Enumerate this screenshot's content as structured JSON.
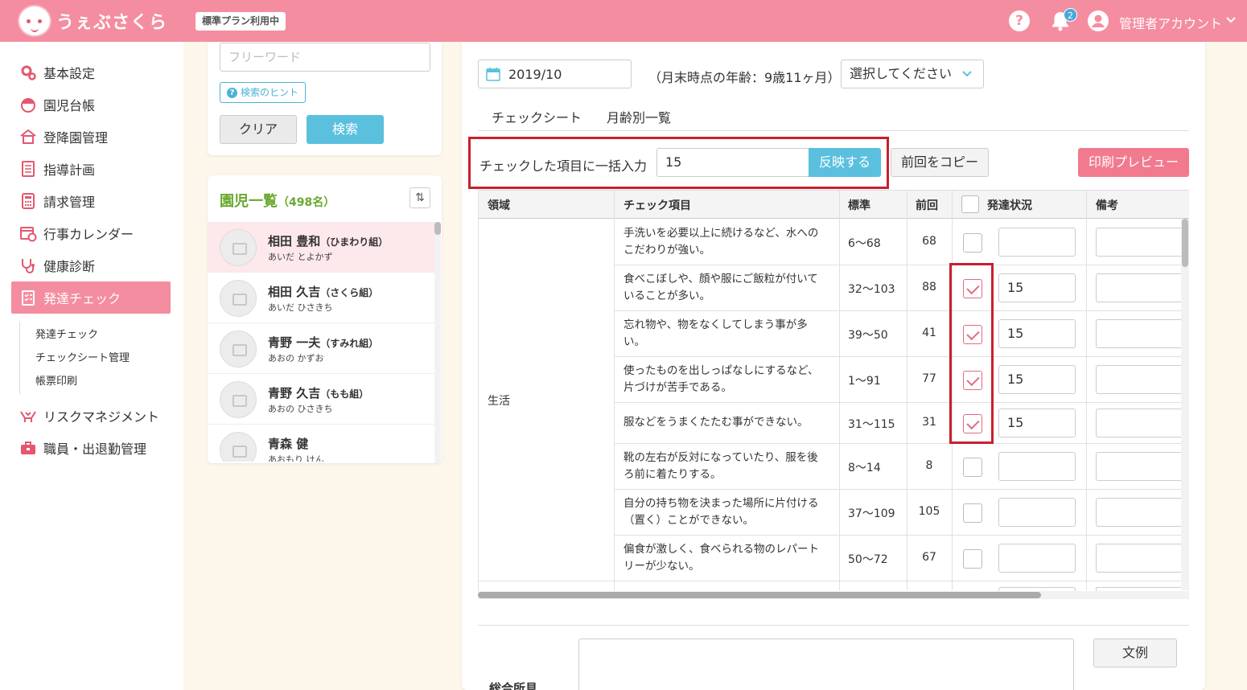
{
  "header": {
    "app_name": "うぇぶさくら",
    "plan_badge": "標準プラン利用中",
    "notification_count": "2",
    "account_name": "管理者アカウント",
    "brand_color": "#f48da0"
  },
  "sidebar": {
    "items": [
      {
        "label": "基本設定",
        "icon": "gear-icon"
      },
      {
        "label": "園児台帳",
        "icon": "child-icon"
      },
      {
        "label": "登降園管理",
        "icon": "house-icon"
      },
      {
        "label": "指導計画",
        "icon": "notebook-icon"
      },
      {
        "label": "請求管理",
        "icon": "calculator-icon"
      },
      {
        "label": "行事カレンダー",
        "icon": "calendar-icon"
      },
      {
        "label": "健康診断",
        "icon": "stethoscope-icon"
      },
      {
        "label": "発達チェック",
        "icon": "checklist-icon"
      },
      {
        "label": "リスクマネジメント",
        "icon": "hands-icon"
      },
      {
        "label": "職員・出退勤管理",
        "icon": "briefcase-icon"
      }
    ],
    "sub_items": [
      "発達チェック",
      "チェックシート管理",
      "帳票印刷"
    ]
  },
  "search": {
    "placeholder": "フリーワード",
    "hint_label": "検索のヒント",
    "clear_label": "クリア",
    "search_label": "検索"
  },
  "child_list": {
    "title": "園児一覧",
    "count": "（498名）",
    "rows": [
      {
        "name": "相田 豊和",
        "class": "（ひまわり組）",
        "kana": "あいだ とよかず"
      },
      {
        "name": "相田 久吉",
        "class": "（さくら組）",
        "kana": "あいだ ひさきち"
      },
      {
        "name": "青野 一夫",
        "class": "（すみれ組）",
        "kana": "あおの かずお"
      },
      {
        "name": "青野 久吉",
        "class": "（もも組）",
        "kana": "あおの ひさきち"
      },
      {
        "name": "青森 健",
        "class": "",
        "kana": "あおもり けん"
      }
    ]
  },
  "main": {
    "date": "2019/10",
    "age_text": "（月末時点の年齢：9歳11ヶ月）",
    "select_placeholder": "選択してください",
    "tabs": [
      "チェックシート",
      "月齢別一覧"
    ],
    "bulk_label": "チェックした項目に一括入力",
    "bulk_value": "15",
    "bulk_apply": "反映する",
    "copy_prev": "前回をコピー",
    "print_preview": "印刷プレビュー",
    "columns": [
      "領域",
      "チェック項目",
      "標準",
      "前回",
      "発達状況",
      "備考"
    ],
    "domain": "生活",
    "rows": [
      {
        "item": "手洗いを必要以上に続けるなど、水へのこだわりが強い。",
        "std": "6〜68",
        "prev": "68",
        "checked": false,
        "status": ""
      },
      {
        "item": "食べこぼしや、顔や服にご飯粒が付いていることが多い。",
        "std": "32〜103",
        "prev": "88",
        "checked": true,
        "status": "15"
      },
      {
        "item": "忘れ物や、物をなくしてしまう事が多い。",
        "std": "39〜50",
        "prev": "41",
        "checked": true,
        "status": "15"
      },
      {
        "item": "使ったものを出しっぱなしにするなど、片づけが苦手である。",
        "std": "1〜91",
        "prev": "77",
        "checked": true,
        "status": "15"
      },
      {
        "item": "服などをうまくたたむ事ができない。",
        "std": "31〜115",
        "prev": "31",
        "checked": true,
        "status": "15"
      },
      {
        "item": "靴の左右が反対になっていたり、服を後ろ前に着たりする。",
        "std": "8〜14",
        "prev": "8",
        "checked": false,
        "status": ""
      },
      {
        "item": "自分の持ち物を決まった場所に片付ける（置く）ことができない。",
        "std": "37〜109",
        "prev": "105",
        "checked": false,
        "status": ""
      },
      {
        "item": "偏食が激しく、食べられる物のレパートリーが少ない。",
        "std": "50〜72",
        "prev": "67",
        "checked": false,
        "status": ""
      }
    ],
    "comment_label": "総合所見",
    "example_label": "文例"
  }
}
